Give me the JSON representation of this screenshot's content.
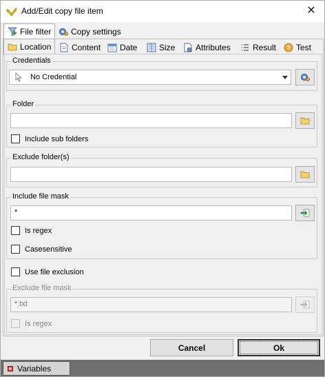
{
  "window": {
    "title": "Add/Edit copy file item",
    "close_symbol": "✕"
  },
  "top_tabs": [
    {
      "label": "File filter",
      "icon": "filter-icon",
      "active": true
    },
    {
      "label": "Copy settings",
      "icon": "gear-icon",
      "active": false
    }
  ],
  "sub_tabs": [
    {
      "label": "Location",
      "icon": "folder-icon",
      "active": true
    },
    {
      "label": "Content",
      "icon": "document-icon",
      "active": false
    },
    {
      "label": "Date",
      "icon": "calendar-icon",
      "active": false
    },
    {
      "label": "Size",
      "icon": "size-icon",
      "active": false
    },
    {
      "label": "Attributes",
      "icon": "attributes-icon",
      "active": false
    },
    {
      "label": "Result",
      "icon": "list-icon",
      "active": false
    },
    {
      "label": "Test",
      "icon": "help-icon",
      "active": false
    }
  ],
  "credentials": {
    "label": "Credentials",
    "selected": "No Credential"
  },
  "folder": {
    "label": "Folder",
    "value": "",
    "include_sub_folders": "Include sub folders"
  },
  "exclude_folders": {
    "label": "Exclude folder(s)",
    "value": ""
  },
  "include_mask": {
    "label": "Include file mask",
    "value": "*",
    "is_regex": "Is regex",
    "casesensitive": "Casesensitive"
  },
  "use_file_exclusion": "Use file exclusion",
  "exclude_mask": {
    "label": "Exclude file mask",
    "value": "*.txt",
    "is_regex": "Is regex"
  },
  "buttons": {
    "cancel": "Cancel",
    "ok": "Ok"
  },
  "statusbar": {
    "variables": "Variables"
  }
}
